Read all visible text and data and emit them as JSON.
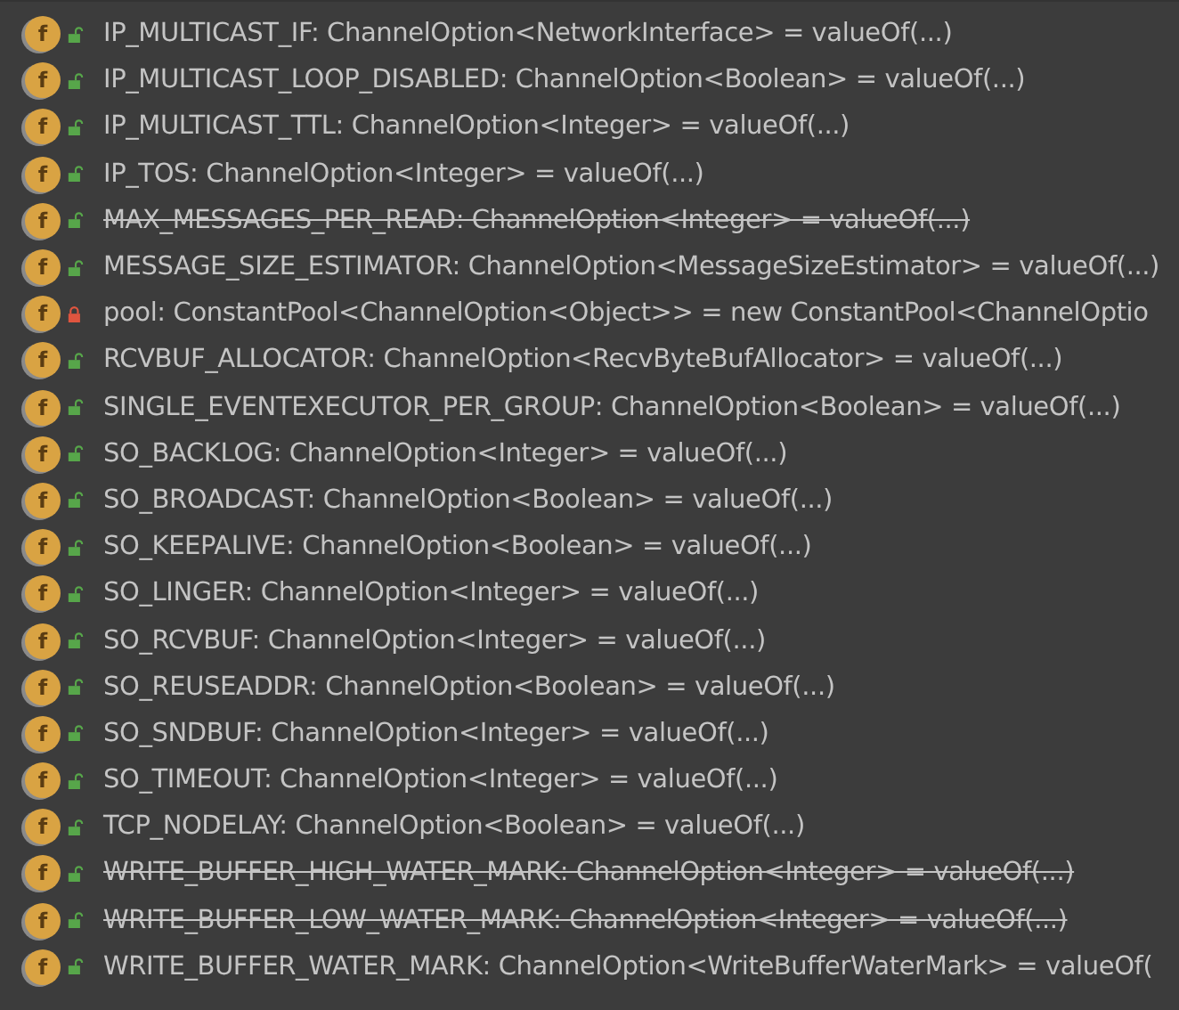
{
  "members": [
    {
      "badge": "f",
      "locked": false,
      "deprecated": false,
      "text": "IP_MULTICAST_IF: ChannelOption<NetworkInterface> = valueOf(...)"
    },
    {
      "badge": "f",
      "locked": false,
      "deprecated": false,
      "text": "IP_MULTICAST_LOOP_DISABLED: ChannelOption<Boolean> = valueOf(...)"
    },
    {
      "badge": "f",
      "locked": false,
      "deprecated": false,
      "text": "IP_MULTICAST_TTL: ChannelOption<Integer> = valueOf(...)"
    },
    {
      "badge": "f",
      "locked": false,
      "deprecated": false,
      "text": "IP_TOS: ChannelOption<Integer> = valueOf(...)"
    },
    {
      "badge": "f",
      "locked": false,
      "deprecated": true,
      "text": "MAX_MESSAGES_PER_READ: ChannelOption<Integer> = valueOf(...)"
    },
    {
      "badge": "f",
      "locked": false,
      "deprecated": false,
      "text": "MESSAGE_SIZE_ESTIMATOR: ChannelOption<MessageSizeEstimator> = valueOf(...)"
    },
    {
      "badge": "f",
      "locked": true,
      "deprecated": false,
      "text": "pool: ConstantPool<ChannelOption<Object>> = new ConstantPool<ChannelOptio"
    },
    {
      "badge": "f",
      "locked": false,
      "deprecated": false,
      "text": "RCVBUF_ALLOCATOR: ChannelOption<RecvByteBufAllocator> = valueOf(...)"
    },
    {
      "badge": "f",
      "locked": false,
      "deprecated": false,
      "text": "SINGLE_EVENTEXECUTOR_PER_GROUP: ChannelOption<Boolean> = valueOf(...)"
    },
    {
      "badge": "f",
      "locked": false,
      "deprecated": false,
      "text": "SO_BACKLOG: ChannelOption<Integer> = valueOf(...)"
    },
    {
      "badge": "f",
      "locked": false,
      "deprecated": false,
      "text": "SO_BROADCAST: ChannelOption<Boolean> = valueOf(...)"
    },
    {
      "badge": "f",
      "locked": false,
      "deprecated": false,
      "text": "SO_KEEPALIVE: ChannelOption<Boolean> = valueOf(...)"
    },
    {
      "badge": "f",
      "locked": false,
      "deprecated": false,
      "text": "SO_LINGER: ChannelOption<Integer> = valueOf(...)"
    },
    {
      "badge": "f",
      "locked": false,
      "deprecated": false,
      "text": "SO_RCVBUF: ChannelOption<Integer> = valueOf(...)"
    },
    {
      "badge": "f",
      "locked": false,
      "deprecated": false,
      "text": "SO_REUSEADDR: ChannelOption<Boolean> = valueOf(...)"
    },
    {
      "badge": "f",
      "locked": false,
      "deprecated": false,
      "text": "SO_SNDBUF: ChannelOption<Integer> = valueOf(...)"
    },
    {
      "badge": "f",
      "locked": false,
      "deprecated": false,
      "text": "SO_TIMEOUT: ChannelOption<Integer> = valueOf(...)"
    },
    {
      "badge": "f",
      "locked": false,
      "deprecated": false,
      "text": "TCP_NODELAY: ChannelOption<Boolean> = valueOf(...)"
    },
    {
      "badge": "f",
      "locked": false,
      "deprecated": true,
      "text": "WRITE_BUFFER_HIGH_WATER_MARK: ChannelOption<Integer> = valueOf(...)"
    },
    {
      "badge": "f",
      "locked": false,
      "deprecated": true,
      "text": "WRITE_BUFFER_LOW_WATER_MARK: ChannelOption<Integer> = valueOf(...)"
    },
    {
      "badge": "f",
      "locked": false,
      "deprecated": false,
      "text": "WRITE_BUFFER_WATER_MARK: ChannelOption<WriteBufferWaterMark> = valueOf("
    }
  ]
}
